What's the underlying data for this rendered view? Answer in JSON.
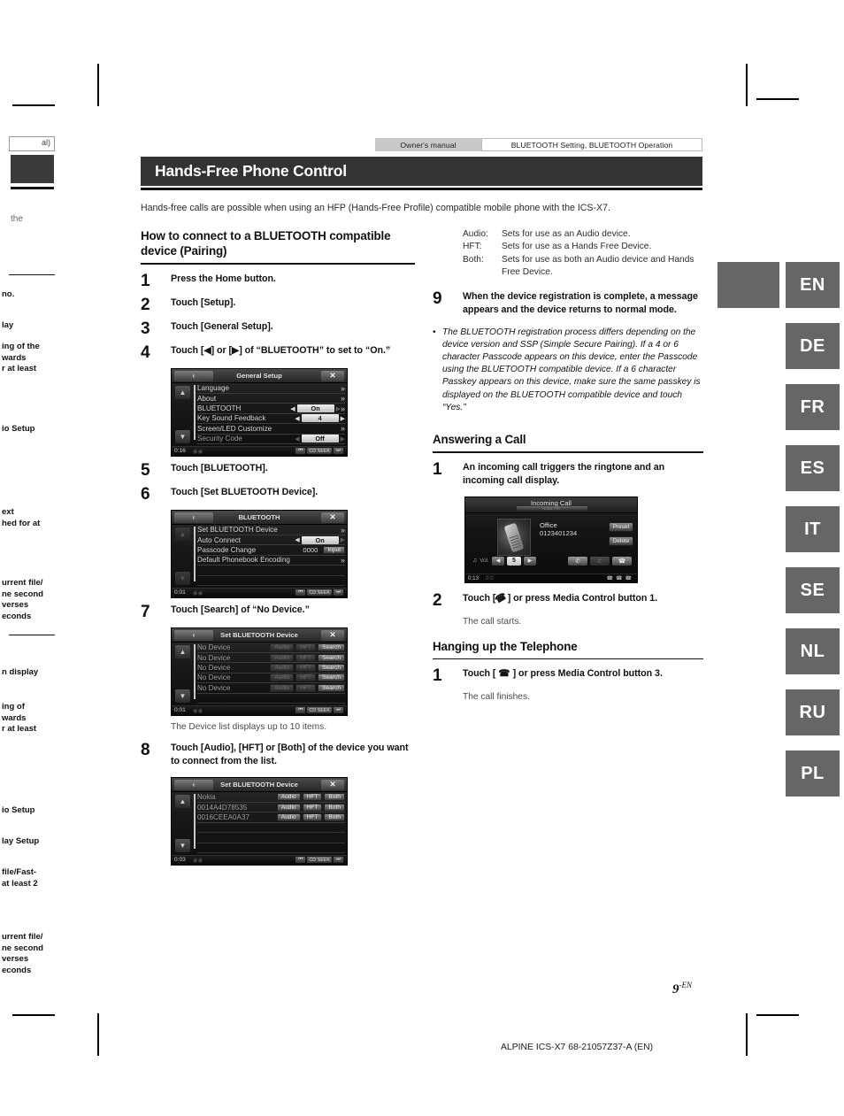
{
  "header": {
    "tab_left": "Owner's manual",
    "tab_right": "BLUETOOTH Setting, BLUETOOTH Operation",
    "title": "Hands-Free Phone Control",
    "intro": "Hands-free calls are possible when using an HFP (Hands-Free Profile) compatible mobile phone with the ICS-X7."
  },
  "left_column": {
    "section_title": "How to connect to a BLUETOOTH compatible device (Pairing)",
    "steps": [
      {
        "num": "1",
        "text": "Press the Home button."
      },
      {
        "num": "2",
        "text": "Touch [Setup]."
      },
      {
        "num": "3",
        "text": "Touch [General Setup]."
      },
      {
        "num": "4",
        "text": "Touch [◀] or [▶] of “BLUETOOTH” to set to “On.”"
      },
      {
        "num": "5",
        "text": "Touch [BLUETOOTH]."
      },
      {
        "num": "6",
        "text": "Touch [Set BLUETOOTH Device]."
      },
      {
        "num": "7",
        "text": "Touch [Search] of “No Device.”"
      },
      {
        "num": "8",
        "text": "Touch [Audio], [HFT] or [Both] of the device you want to connect from the list."
      }
    ],
    "device_list_note": "The Device list displays up to 10 items."
  },
  "screens": {
    "general_setup": {
      "back_label": "‹",
      "title": "General Setup",
      "close_label": "✕",
      "time": "0:16",
      "rows": [
        {
          "label": "Language",
          "type": "chevron"
        },
        {
          "label": "About",
          "type": "chevron"
        },
        {
          "label": "BLUETOOTH",
          "type": "value-chevron",
          "value": "On",
          "left_arrow": "◀",
          "right_arrow": "▶"
        },
        {
          "label": "Key Sound Feedback",
          "type": "value",
          "value": "4",
          "left_arrow": "◀",
          "right_arrow": "▶"
        },
        {
          "label": "Screen/LED Customize",
          "type": "chevron"
        },
        {
          "label": "Security Code",
          "type": "value",
          "value": "Off",
          "left_arrow": "◀",
          "right_arrow": "▶"
        }
      ],
      "foot_buttons": [
        "⏮",
        "CD SEEK",
        "⏭"
      ]
    },
    "bluetooth": {
      "back_label": "‹",
      "title": "BLUETOOTH",
      "close_label": "✕",
      "time": "0:01",
      "rows": [
        {
          "label": "Set BLUETOOTH Device",
          "type": "chevron"
        },
        {
          "label": "Auto Connect",
          "type": "value",
          "value": "On",
          "left_arrow": "◀",
          "right_arrow": "▶"
        },
        {
          "label": "Passcode Change",
          "type": "passcode",
          "value": "0000",
          "button": "Input"
        },
        {
          "label": "Default Phonebook Encoding",
          "type": "chevron"
        }
      ],
      "foot_buttons": [
        "⏮",
        "CD SEEK",
        "⏭"
      ]
    },
    "set_device_empty": {
      "back_label": "‹",
      "title": "Set BLUETOOTH Device",
      "close_label": "✕",
      "time": "0:01",
      "rows": [
        {
          "label": "No Device",
          "buttons": [
            "Audio",
            "HFT",
            "Search"
          ],
          "active": [
            false,
            false,
            true
          ]
        },
        {
          "label": "No Device",
          "buttons": [
            "Audio",
            "HFT",
            "Search"
          ],
          "active": [
            false,
            false,
            true
          ]
        },
        {
          "label": "No Device",
          "buttons": [
            "Audio",
            "HFT",
            "Search"
          ],
          "active": [
            false,
            false,
            true
          ]
        },
        {
          "label": "No Device",
          "buttons": [
            "Audio",
            "HFT",
            "Search"
          ],
          "active": [
            false,
            false,
            true
          ]
        },
        {
          "label": "No Device",
          "buttons": [
            "Audio",
            "HFT",
            "Search"
          ],
          "active": [
            false,
            false,
            true
          ]
        }
      ],
      "foot_buttons": [
        "⏮",
        "CD SEEK",
        "⏭"
      ]
    },
    "set_device_list": {
      "back_label": "‹",
      "title": "Set BLUETOOTH Device",
      "close_label": "✕",
      "time": "0:03",
      "rows": [
        {
          "label": "Nokia",
          "buttons": [
            "Audio",
            "HFT",
            "Both"
          ],
          "active": [
            true,
            true,
            true
          ]
        },
        {
          "label": "0014A4D78535",
          "buttons": [
            "Audio",
            "HFT",
            "Both"
          ],
          "active": [
            true,
            true,
            true
          ]
        },
        {
          "label": "0016CEEA0A37",
          "buttons": [
            "Audio",
            "HFT",
            "Both"
          ],
          "active": [
            true,
            true,
            true
          ]
        }
      ],
      "foot_buttons": [
        "⏮",
        "CD SEEK",
        "⏭"
      ]
    },
    "incoming_call": {
      "title": "Incoming Call",
      "subtitle": "Nokia 700",
      "caller_name": "Office",
      "caller_number": "0123401234",
      "preset_label": "Preset",
      "delete_label": "Delete",
      "vol_label": "Vol.",
      "vol_value": "5",
      "vol_left": "◀",
      "vol_right": "▶",
      "answer_icon": "✆",
      "mute_icon": "✆",
      "hangup_icon": "☎",
      "time": "0:13",
      "status": "0:0"
    }
  },
  "right_column": {
    "definitions": [
      {
        "term": "Audio:",
        "desc": "Sets for use as an Audio device."
      },
      {
        "term": "HFT:",
        "desc": "Sets for use as a Hands Free Device."
      },
      {
        "term": "Both:",
        "desc": "Sets for use as both an Audio device and Hands Free Device."
      }
    ],
    "step9": {
      "num": "9",
      "text": "When the device registration is complete, a message appears and the device returns to normal mode."
    },
    "bullet": "The BLUETOOTH registration process differs depending on the device version and SSP (Simple Secure Pairing). If a 4 or 6 character Passcode appears on this device, enter the Passcode using the BLUETOOTH compatible device. If a 6 character Passkey appears on this device, make sure the same passkey is displayed on the BLUETOOTH compatible device and touch “Yes.”",
    "answering": {
      "section_title": "Answering a Call",
      "step1_num": "1",
      "step1_text": "An incoming call triggers the ringtone and an incoming call display.",
      "step2_num": "2",
      "step2_text_a": "Touch [",
      "step2_text_b": "] or press Media Control button 1.",
      "step2_note": "The call starts."
    },
    "hangup": {
      "section_title": "Hanging up the Telephone",
      "step1_num": "1",
      "step1_text_a": "Touch [",
      "step1_text_b": "] or press Media Control button 3.",
      "step1_note": "The call finishes."
    }
  },
  "language_tabs": [
    "EN",
    "DE",
    "FR",
    "ES",
    "IT",
    "SE",
    "NL",
    "RU",
    "PL"
  ],
  "page_number": "9",
  "page_number_suffix": "-EN",
  "footer": "ALPINE ICS-X7 68-21057Z37-A (EN)",
  "bleed": {
    "box_text": "al)",
    "t1": "the",
    "t2": "no.",
    "t3": "lay",
    "t4": "ing of the\nwards\nr at least",
    "t5": "io Setup",
    "t6": "ext\nhed for at",
    "t7": "urrent file/\nne second\nverses\neconds",
    "t8": "n display",
    "t9": "ing of\nwards\nr at least",
    "t10": "io Setup",
    "t11": "lay Setup",
    "t12": "file/Fast-\nat least 2",
    "t13": "urrent file/\nne second\nverses\neconds"
  }
}
